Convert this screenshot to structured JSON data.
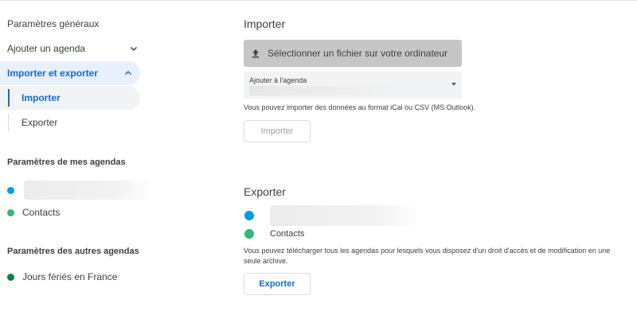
{
  "sidebar": {
    "general_settings": "Paramètres généraux",
    "add_calendar": "Ajouter un agenda",
    "import_export": "Importer et exporter",
    "sub_import": "Importer",
    "sub_export": "Exporter",
    "my_calendars_heading": "Paramètres de mes agendas",
    "my_calendars": [
      {
        "label": "",
        "color": "#039be5"
      },
      {
        "label": "Contacts",
        "color": "#33b679"
      }
    ],
    "other_calendars_heading": "Paramètres des autres agendas",
    "other_calendars": [
      {
        "label": "Jours fériés en France",
        "color": "#0b8043"
      }
    ]
  },
  "import": {
    "title": "Importer",
    "select_file_label": "Sélectionner un fichier sur votre ordinateur",
    "calendar_select_label": "Ajouter à l'agenda",
    "help_text": "Vous pouvez importer des données au format iCal ou CSV (MS Outlook).",
    "button_label": "Importer"
  },
  "export": {
    "title": "Exporter",
    "calendars": [
      {
        "label": "",
        "color": "#039be5"
      },
      {
        "label": "Contacts",
        "color": "#33b679"
      }
    ],
    "help_text": "Vous pouvez télécharger tous les agendas pour lesquels vous disposez d'un droit d'accès et de modification en une seule archive.",
    "button_label": "Exporter"
  },
  "icons": {
    "chevron_down": "chevron-down-icon",
    "chevron_up": "chevron-up-icon",
    "upload": "upload-icon"
  },
  "colors": {
    "accent": "#1967d2",
    "active_bg": "#e8f0fe"
  }
}
